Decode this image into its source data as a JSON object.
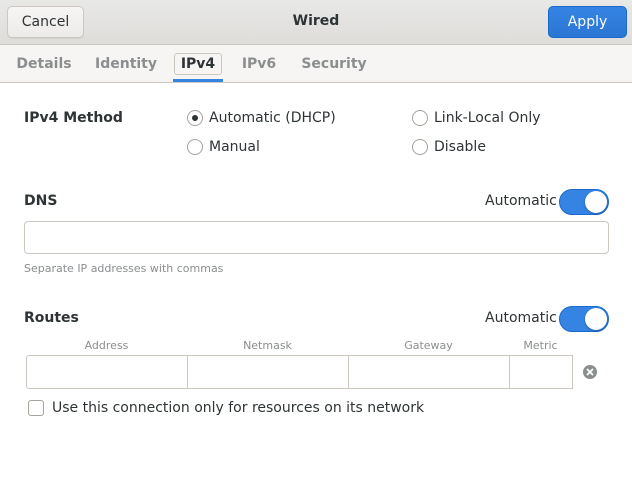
{
  "header": {
    "title": "Wired",
    "cancel_label": "Cancel",
    "apply_label": "Apply"
  },
  "tabs": [
    {
      "label": "Details",
      "active": false
    },
    {
      "label": "Identity",
      "active": false
    },
    {
      "label": "IPv4",
      "active": true
    },
    {
      "label": "IPv6",
      "active": false
    },
    {
      "label": "Security",
      "active": false
    }
  ],
  "ipv4_method": {
    "label": "IPv4 Method",
    "options": [
      {
        "label": "Automatic (DHCP)",
        "selected": true
      },
      {
        "label": "Link-Local Only",
        "selected": false
      },
      {
        "label": "Manual",
        "selected": false
      },
      {
        "label": "Disable",
        "selected": false
      }
    ]
  },
  "dns": {
    "label": "DNS",
    "automatic_label": "Automatic",
    "automatic_on": true,
    "value": "",
    "hint": "Separate IP addresses with commas"
  },
  "routes": {
    "label": "Routes",
    "automatic_label": "Automatic",
    "automatic_on": true,
    "columns": [
      "Address",
      "Netmask",
      "Gateway",
      "Metric"
    ],
    "row": {
      "address": "",
      "netmask": "",
      "gateway": "",
      "metric": ""
    }
  },
  "restrict_checkbox": {
    "label": "Use this connection only for resources on its network",
    "checked": false
  },
  "colors": {
    "accent": "#3584e4",
    "header_bg": "#deddda",
    "text": "#2e3436",
    "dim_text": "#8b8e8f"
  },
  "icons": {
    "remove_route": "remove-circle-icon"
  }
}
